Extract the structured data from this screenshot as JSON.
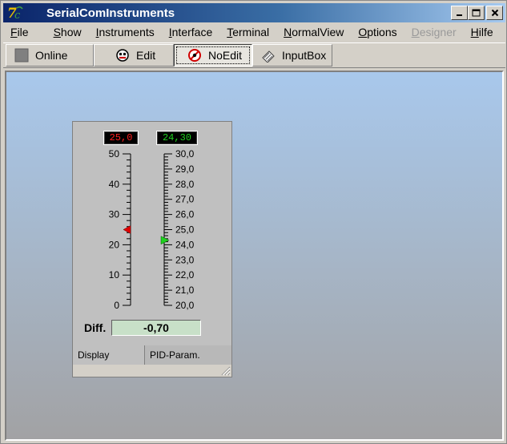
{
  "window": {
    "title": "SerialComInstruments",
    "app_icon": "app-logo-icon",
    "controls": {
      "minimize": "_",
      "maximize": "□",
      "close": "✕"
    }
  },
  "menu": [
    {
      "label": "File",
      "underline": "F",
      "rest": "ile",
      "disabled": false
    },
    {
      "label": "Show",
      "underline": "S",
      "rest": "how",
      "disabled": false
    },
    {
      "label": "Instruments",
      "underline": "I",
      "rest": "nstruments",
      "disabled": false
    },
    {
      "label": "Interface",
      "underline": "I",
      "rest": "nterface",
      "disabled": false
    },
    {
      "label": "Terminal",
      "underline": "T",
      "rest": "erminal",
      "disabled": false
    },
    {
      "label": "NormalView",
      "underline": "N",
      "rest": "ormalView",
      "disabled": false
    },
    {
      "label": "Options",
      "underline": "O",
      "rest": "ptions",
      "disabled": false
    },
    {
      "label": "Designer",
      "underline": "D",
      "rest": "esigner",
      "disabled": true
    },
    {
      "label": "Hilfe",
      "underline": "H",
      "rest": "ilfe",
      "disabled": false
    }
  ],
  "toolbar": {
    "online_label": "Online",
    "edit_label": "Edit",
    "noedit_label": "NoEdit",
    "inputbox_label": "InputBox",
    "pressed": "NoEdit"
  },
  "instrument": {
    "left_display": "25,0",
    "right_display": "24,30",
    "left_scale": {
      "min": 0,
      "max": 50,
      "tick_labels": [
        "50",
        "40",
        "30",
        "20",
        "10",
        "0"
      ],
      "pointer_value": 25.0,
      "pointer_color": "#e00000"
    },
    "right_scale": {
      "min": 20.0,
      "max": 30.0,
      "tick_labels": [
        "30,0",
        "29,0",
        "28,0",
        "27,0",
        "26,0",
        "25,0",
        "24,0",
        "23,0",
        "22,0",
        "21,0",
        "20,0"
      ],
      "pointer_value": 24.3,
      "pointer_color": "#20d020"
    },
    "diff_label": "Diff.",
    "diff_value": "-0,70",
    "tabs": [
      "Display",
      "PID-Param."
    ]
  },
  "colors": {
    "titlebar_start": "#0a246a",
    "titlebar_end": "#a6caf0",
    "display_red": "#ff2020",
    "display_green": "#20d020",
    "diff_bg": "#c8e0c8"
  }
}
